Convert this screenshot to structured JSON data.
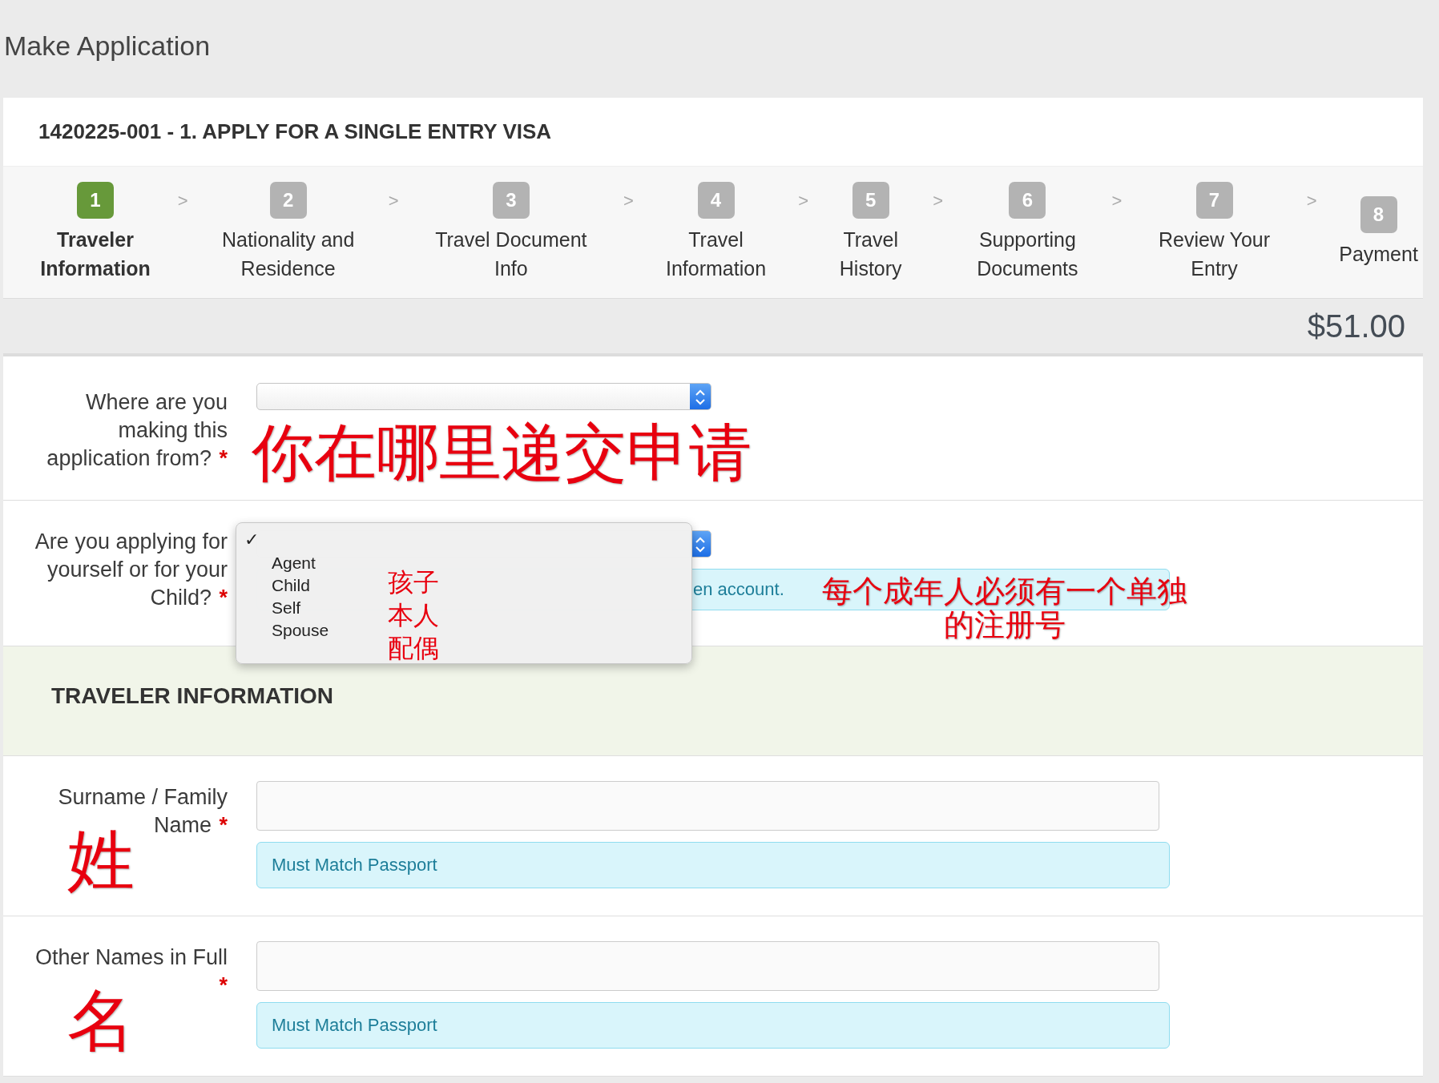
{
  "page_title": "Make Application",
  "application_title": "1420225-001 - 1. APPLY FOR A SINGLE ENTRY VISA",
  "steps": [
    {
      "number": "1",
      "label": "Traveler Information",
      "selected": true,
      "separator": ">"
    },
    {
      "number": "2",
      "label": "Nationality and Residence",
      "selected": false,
      "separator": ">"
    },
    {
      "number": "3",
      "label": "Travel Document Info",
      "selected": false,
      "separator": ">"
    },
    {
      "number": "4",
      "label": "Travel Information",
      "selected": false,
      "separator": ">"
    },
    {
      "number": "5",
      "label": "Travel History",
      "selected": false,
      "separator": ">"
    },
    {
      "number": "6",
      "label": "Supporting Documents",
      "selected": false,
      "separator": ">"
    },
    {
      "number": "7",
      "label": "Review Your Entry",
      "selected": false,
      "separator": ">"
    },
    {
      "number": "8",
      "label": "Payment",
      "selected": false
    }
  ],
  "total": "$51.00",
  "questions": [
    {
      "kind": "select",
      "label": "Where are you making this application from?",
      "required_mark": "*",
      "annotation": "你在哪里递交申请"
    },
    {
      "kind": "select",
      "label": "Are you applying for yourself or for your Child?",
      "required_mark": "*",
      "help": "en account.",
      "help_annotation": "每个成年人必须有一个单独的注册号",
      "menu": {
        "check_mark": "✓",
        "options": [
          {
            "label": "Agent",
            "selected": false
          },
          {
            "label": "Child",
            "selected": false
          },
          {
            "label": "Self",
            "selected": false
          },
          {
            "label": "Spouse",
            "selected": false
          }
        ],
        "annotations": [
          "孩子",
          "本人",
          "配偶"
        ]
      }
    }
  ],
  "section_title": "TRAVELER INFORMATION",
  "fields": [
    {
      "label": "Surname / Family Name",
      "required_mark": "*",
      "annotation": "姓",
      "help": "Must Match Passport"
    },
    {
      "label": "Other Names in Full",
      "required_mark": "*",
      "annotation": "名",
      "help": "Must Match Passport"
    }
  ]
}
